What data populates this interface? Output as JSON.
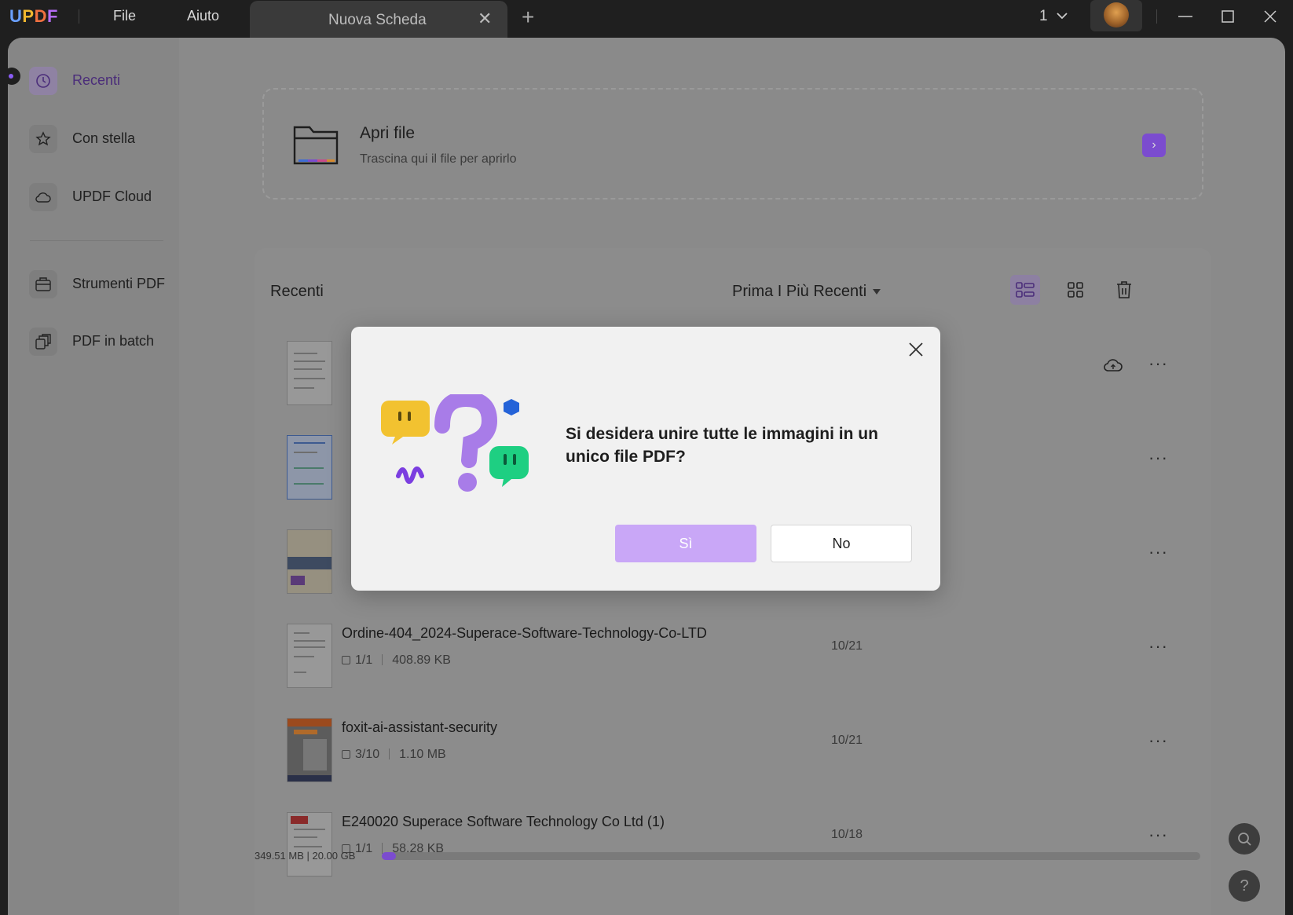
{
  "app": {
    "logo": "UPDF",
    "menu": [
      "File",
      "Aiuto"
    ],
    "tab_title": "Nuova Scheda",
    "page_indicator": "1"
  },
  "sidebar": {
    "items": [
      {
        "label": "Recenti",
        "icon": "clock-icon",
        "active": true
      },
      {
        "label": "Con stella",
        "icon": "star-icon"
      },
      {
        "label": "UPDF Cloud",
        "icon": "cloud-icon"
      },
      {
        "label": "Strumenti PDF",
        "icon": "toolbox-icon"
      },
      {
        "label": "PDF in batch",
        "icon": "batch-icon"
      }
    ]
  },
  "open_file": {
    "title": "Apri file",
    "subtitle": "Trascina qui il file per aprirlo"
  },
  "recent": {
    "title": "Recenti",
    "sort_label": "Prima I Più Recenti",
    "files": [
      {
        "name": "Ordine-404_2024-Superace-Software-Technology-Co-LTD",
        "pages": "1/1",
        "size": "408.89 KB",
        "date": "10/21"
      },
      {
        "name": "foxit-ai-assistant-security",
        "pages": "3/10",
        "size": "1.10 MB",
        "date": "10/21"
      },
      {
        "name": "E240020 Superace Software Technology Co Ltd (1)",
        "pages": "1/1",
        "size": "58.28 KB",
        "date": "10/18"
      }
    ]
  },
  "storage": {
    "text": "349.51 MB | 20.00 GB",
    "used_fraction": 0.017
  },
  "dialog": {
    "message": "Si desidera unire tutte le immagini in un unico file PDF?",
    "yes_label": "Sì",
    "no_label": "No"
  },
  "colors": {
    "accent": "#7b4ccf",
    "yes_button": "#c9a7f7"
  }
}
